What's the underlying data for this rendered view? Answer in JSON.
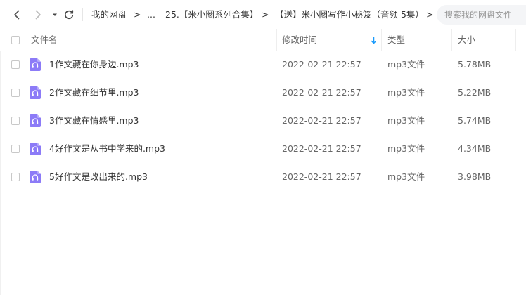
{
  "toolbar": {
    "back_icon": "chevron-left-icon",
    "forward_icon": "chevron-right-icon",
    "history_icon": "caret-down-icon",
    "refresh_icon": "refresh-icon",
    "breadcrumbs": [
      "我的网盘",
      "...",
      "25.【米小圈系列合集】",
      "【送】米小圈写作小秘笈（音频 5集）"
    ],
    "separator": ">",
    "search_placeholder": "搜索我的网盘文件"
  },
  "table": {
    "headers": {
      "name": "文件名",
      "modified": "修改时间",
      "type": "类型",
      "size": "大小"
    },
    "sort_indicator": "arrow-down-icon",
    "accent_color": "#1a9bfc",
    "file_icon_color": "#8c7bf7",
    "rows": [
      {
        "name": "1作文藏在你身边.mp3",
        "modified": "2022-02-21 22:57",
        "type": "mp3文件",
        "size": "5.78MB"
      },
      {
        "name": "2作文藏在细节里.mp3",
        "modified": "2022-02-21 22:57",
        "type": "mp3文件",
        "size": "5.22MB"
      },
      {
        "name": "3作文藏在情感里.mp3",
        "modified": "2022-02-21 22:57",
        "type": "mp3文件",
        "size": "5.74MB"
      },
      {
        "name": "4好作文是从书中学来的.mp3",
        "modified": "2022-02-21 22:57",
        "type": "mp3文件",
        "size": "4.34MB"
      },
      {
        "name": "5好作文是改出来的.mp3",
        "modified": "2022-02-21 22:57",
        "type": "mp3文件",
        "size": "3.98MB"
      }
    ]
  }
}
